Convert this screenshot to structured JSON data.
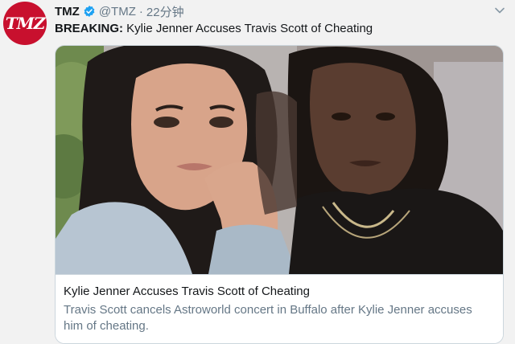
{
  "account": {
    "avatar_text": "TMZ",
    "name": "TMZ",
    "handle": "@TMZ",
    "separator": "·",
    "time": "22分钟",
    "verified_color": "#1da1f2",
    "brand_color": "#c8102e"
  },
  "tweet": {
    "prefix": "BREAKING:",
    "text": " Kylie Jenner Accuses Travis Scott of Cheating"
  },
  "card": {
    "image_icon": "photo-kylie-jenner-travis-scott",
    "title": "Kylie Jenner Accuses Travis Scott of Cheating",
    "description": "Travis Scott cancels Astroworld concert in Buffalo after Kylie Jenner accuses him of cheating."
  },
  "icons": {
    "verified": "verified-badge-icon",
    "more": "chevron-down-icon"
  }
}
